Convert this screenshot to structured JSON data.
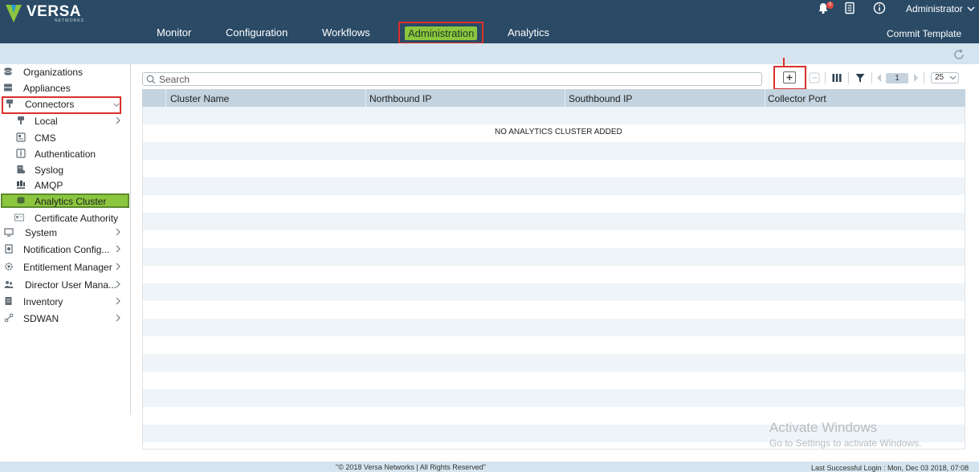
{
  "brand": {
    "name": "VERSA",
    "sub": "NETWORKS"
  },
  "header": {
    "nav": [
      {
        "label": "Monitor"
      },
      {
        "label": "Configuration"
      },
      {
        "label": "Workflows"
      },
      {
        "label": "Administration",
        "active": true
      },
      {
        "label": "Analytics"
      }
    ],
    "notification_count": "0",
    "user": "Administrator",
    "commit_label": "Commit Template"
  },
  "sidebar": {
    "items": [
      {
        "label": "Organizations",
        "icon": "organizations-icon"
      },
      {
        "label": "Appliances",
        "icon": "appliances-icon"
      },
      {
        "label": "Connectors",
        "icon": "connector-plug-icon",
        "expanded": true
      },
      {
        "label": "Local",
        "icon": "local-icon",
        "has_children": true
      },
      {
        "label": "CMS",
        "icon": "cms-icon"
      },
      {
        "label": "Authentication",
        "icon": "authentication-icon"
      },
      {
        "label": "Syslog",
        "icon": "syslog-icon"
      },
      {
        "label": "AMQP",
        "icon": "amqp-icon"
      },
      {
        "label": "Analytics Cluster",
        "icon": "analytics-cluster-icon",
        "selected": true
      },
      {
        "label": "Certificate Authority",
        "icon": "certificate-icon"
      },
      {
        "label": "System",
        "icon": "system-icon",
        "has_children": true
      },
      {
        "label": "Notification Config...",
        "icon": "notification-config-icon",
        "has_children": true
      },
      {
        "label": "Entitlement Manager",
        "icon": "entitlement-gear-icon",
        "has_children": true
      },
      {
        "label": "Director User Mana...",
        "icon": "users-icon",
        "has_children": true
      },
      {
        "label": "Inventory",
        "icon": "inventory-icon",
        "has_children": true
      },
      {
        "label": "SDWAN",
        "icon": "sdwan-icon",
        "has_children": true
      }
    ]
  },
  "toolbar": {
    "search_placeholder": "Search",
    "page_number": "1",
    "page_size": "25"
  },
  "table": {
    "columns": [
      "Cluster Name",
      "Northbound IP",
      "Southbound IP",
      "Collector Port"
    ],
    "empty_message": "NO ANALYTICS CLUSTER ADDED"
  },
  "watermark": {
    "line1": "Activate Windows",
    "line2": "Go to Settings to activate Windows."
  },
  "footer": {
    "copyright": "\"© 2018 Versa Networks | All Rights Reserved\"",
    "last_login": "Last Successful Login : Mon, Dec 03 2018, 07:08"
  },
  "colors": {
    "header_bg": "#2a4a66",
    "band_bg": "#d5e4ee",
    "active_green": "#8cc63f",
    "highlight_red": "#d9302c",
    "table_header_bg": "#c3d3df",
    "row_stripe": "#eef4f8"
  }
}
